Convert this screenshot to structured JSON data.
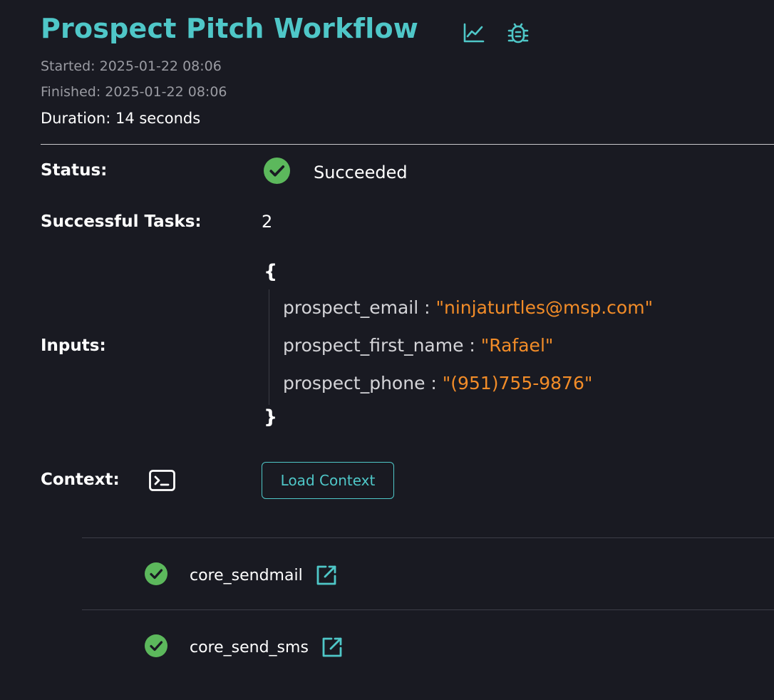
{
  "header": {
    "title": "Prospect Pitch Workflow",
    "icons": [
      "chart-line-icon",
      "bug-icon"
    ],
    "started": "Started: 2025-01-22 08:06",
    "finished": "Finished: 2025-01-22 08:06",
    "duration": "Duration: 14 seconds"
  },
  "status": {
    "label": "Status:",
    "value": "Succeeded",
    "icon": "check-circle-icon",
    "color": "#5cb85c"
  },
  "successful_tasks": {
    "label": "Successful Tasks:",
    "value": "2"
  },
  "inputs": {
    "label": "Inputs:",
    "open_brace": "{",
    "close_brace": "}",
    "entries": [
      {
        "key": "prospect_email",
        "sep": " : ",
        "value": "\"ninjaturtles@msp.com\""
      },
      {
        "key": "prospect_first_name",
        "sep": " : ",
        "value": "\"Rafael\""
      },
      {
        "key": "prospect_phone",
        "sep": " : ",
        "value": "\"(951)755-9876\""
      }
    ]
  },
  "context": {
    "label": "Context:",
    "icon": "terminal-icon",
    "button_label": "Load Context"
  },
  "tasks": [
    {
      "name": "core_sendmail",
      "status_icon": "check-circle-icon",
      "link_icon": "external-link-icon"
    },
    {
      "name": "core_send_sms",
      "status_icon": "check-circle-icon",
      "link_icon": "external-link-icon"
    }
  ],
  "colors": {
    "accent": "#4fc7c8",
    "success": "#5cb85c",
    "json_value": "#f28c28",
    "background": "#191a22"
  }
}
